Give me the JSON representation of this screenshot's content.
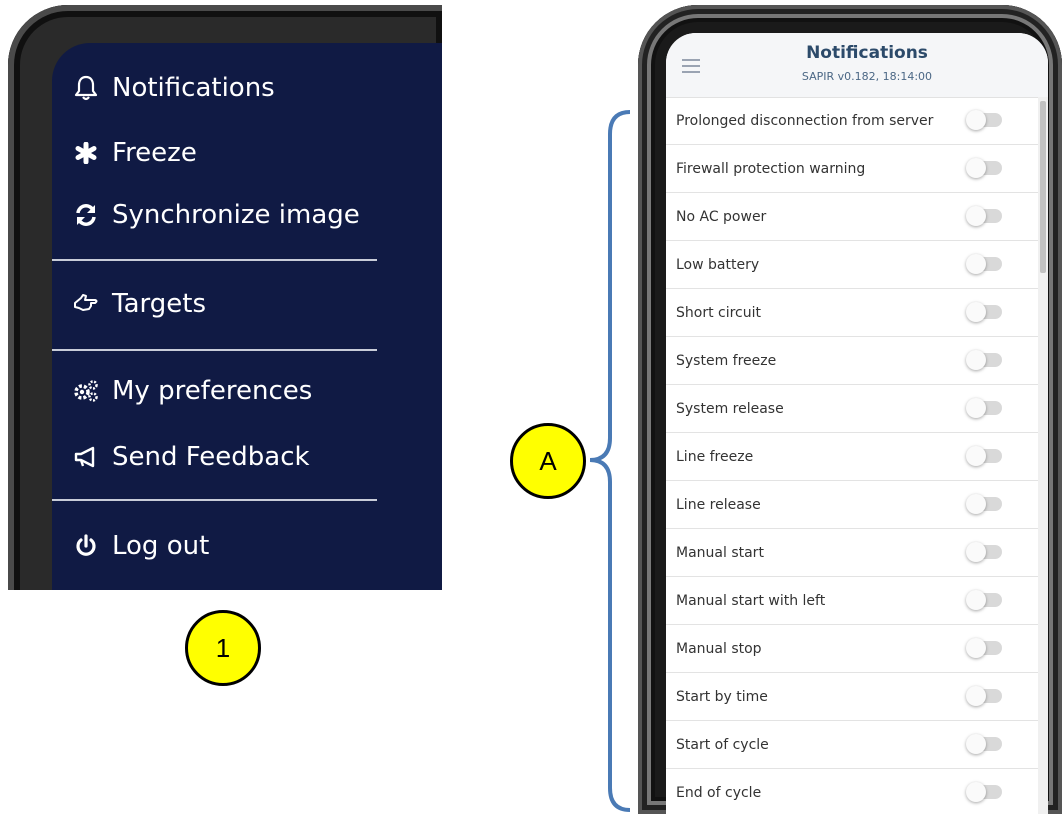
{
  "menu": {
    "items": [
      {
        "label": "Notifications",
        "icon": "bell-icon"
      },
      {
        "label": "Freeze",
        "icon": "asterisk-icon"
      },
      {
        "label": "Synchronize image",
        "icon": "sync-icon"
      },
      {
        "label": "Targets",
        "icon": "hand-point-icon"
      },
      {
        "label": "My preferences",
        "icon": "gears-icon"
      },
      {
        "label": "Send Feedback",
        "icon": "megaphone-icon"
      },
      {
        "label": "Log out",
        "icon": "power-icon"
      }
    ]
  },
  "callouts": {
    "one": "1",
    "a": "A"
  },
  "notifications_screen": {
    "title": "Notifications",
    "subtitle": "SAPIR v0.182, 18:14:00",
    "rows": [
      "Prolonged disconnection from server",
      "Firewall protection warning",
      "No AC power",
      "Low battery",
      "Short circuit",
      "System freeze",
      "System release",
      "Line freeze",
      "Line release",
      "Manual start",
      "Manual start with left",
      "Manual stop",
      "Start by time",
      "Start of cycle",
      "End of cycle"
    ]
  },
  "colors": {
    "menu_bg": "#101a44",
    "callout_fill": "#ffff00",
    "bracket": "#4a7ab5",
    "title": "#2c4a6a"
  }
}
